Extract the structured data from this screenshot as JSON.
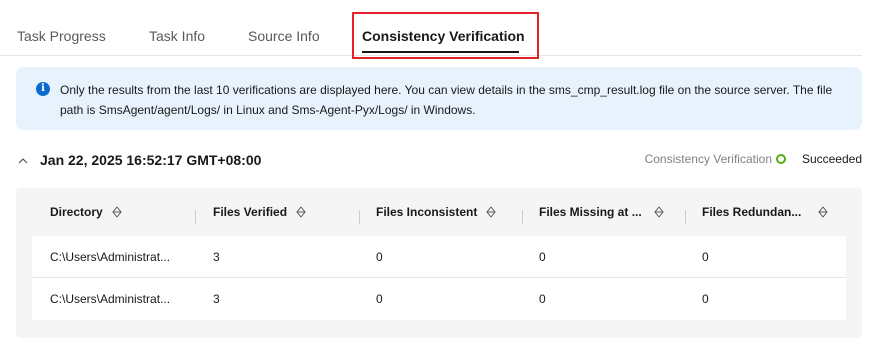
{
  "tabs": [
    {
      "label": "Task Progress",
      "active": false
    },
    {
      "label": "Task Info",
      "active": false
    },
    {
      "label": "Source Info",
      "active": false
    },
    {
      "label": "Consistency Verification",
      "active": true
    }
  ],
  "notice": {
    "icon": "info-icon",
    "text": "Only the results from the last 10 verifications are displayed here. You can view details in the sms_cmp_result.log file on the source server. The file path is SmsAgent/agent/Logs/ in Linux and Sms-Agent-Pyx/Logs/ in Windows."
  },
  "run": {
    "timestamp": "Jan 22, 2025 16:52:17 GMT+08:00",
    "type_label": "Consistency Verification",
    "status": "Succeeded",
    "status_color": "#50b012"
  },
  "table": {
    "columns": [
      "Directory",
      "Files Verified",
      "Files Inconsistent",
      "Files Missing at ...",
      "Files Redundan..."
    ],
    "rows": [
      [
        "C:\\Users\\Administrat...",
        "3",
        "0",
        "0",
        "0"
      ],
      [
        "C:\\Users\\Administrat...",
        "3",
        "0",
        "0",
        "0"
      ]
    ]
  },
  "colors": {
    "accent": "#0b6ad1",
    "highlight": "#e8202a",
    "notice_bg": "#e8f2fd"
  }
}
